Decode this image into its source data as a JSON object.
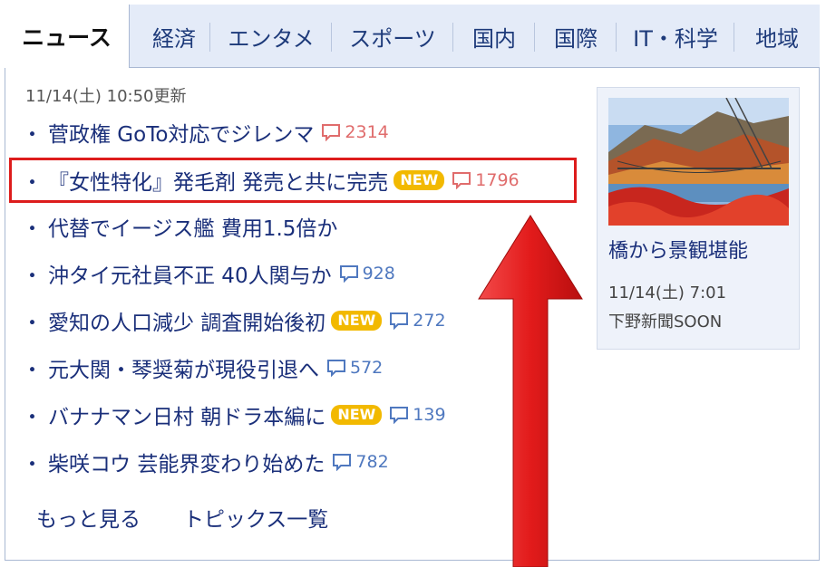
{
  "tabs": {
    "active": "ニュース",
    "items": [
      "経済",
      "エンタメ",
      "スポーツ",
      "国内",
      "国際",
      "IT・科学",
      "地域"
    ]
  },
  "timestamp": "11/14(土) 10:50更新",
  "news": [
    {
      "title": "菅政権 GoTo対応でジレンマ",
      "new_badge": "",
      "comments": "2314"
    },
    {
      "title": "『女性特化』発毛剤 発売と共に完売",
      "new_badge": "NEW",
      "comments": "1796"
    },
    {
      "title": "代替でイージス艦 費用1.5倍か",
      "new_badge": "",
      "comments": ""
    },
    {
      "title": "沖タイ元社員不正 40人関与か",
      "new_badge": "",
      "comments": "928"
    },
    {
      "title": "愛知の人口減少 調査開始後初",
      "new_badge": "NEW",
      "comments": "272"
    },
    {
      "title": "元大関・琴奨菊が現役引退へ",
      "new_badge": "",
      "comments": "572"
    },
    {
      "title": "バナナマン日村 朝ドラ本編に",
      "new_badge": "NEW",
      "comments": "139"
    },
    {
      "title": "柴咲コウ 芸能界変わり始めた",
      "new_badge": "",
      "comments": "782"
    }
  ],
  "links": {
    "more": "もっと見る",
    "topics": "トピックス一覧"
  },
  "feature": {
    "title": "橋から景観堪能",
    "date": "11/14(土) 7:01",
    "source": "下野新聞SOON"
  },
  "colors": {
    "link": "#1a2f7a",
    "new_badge": "#f2b900",
    "highlight": "#dd1c1c",
    "arrow": "#e21b1b"
  }
}
